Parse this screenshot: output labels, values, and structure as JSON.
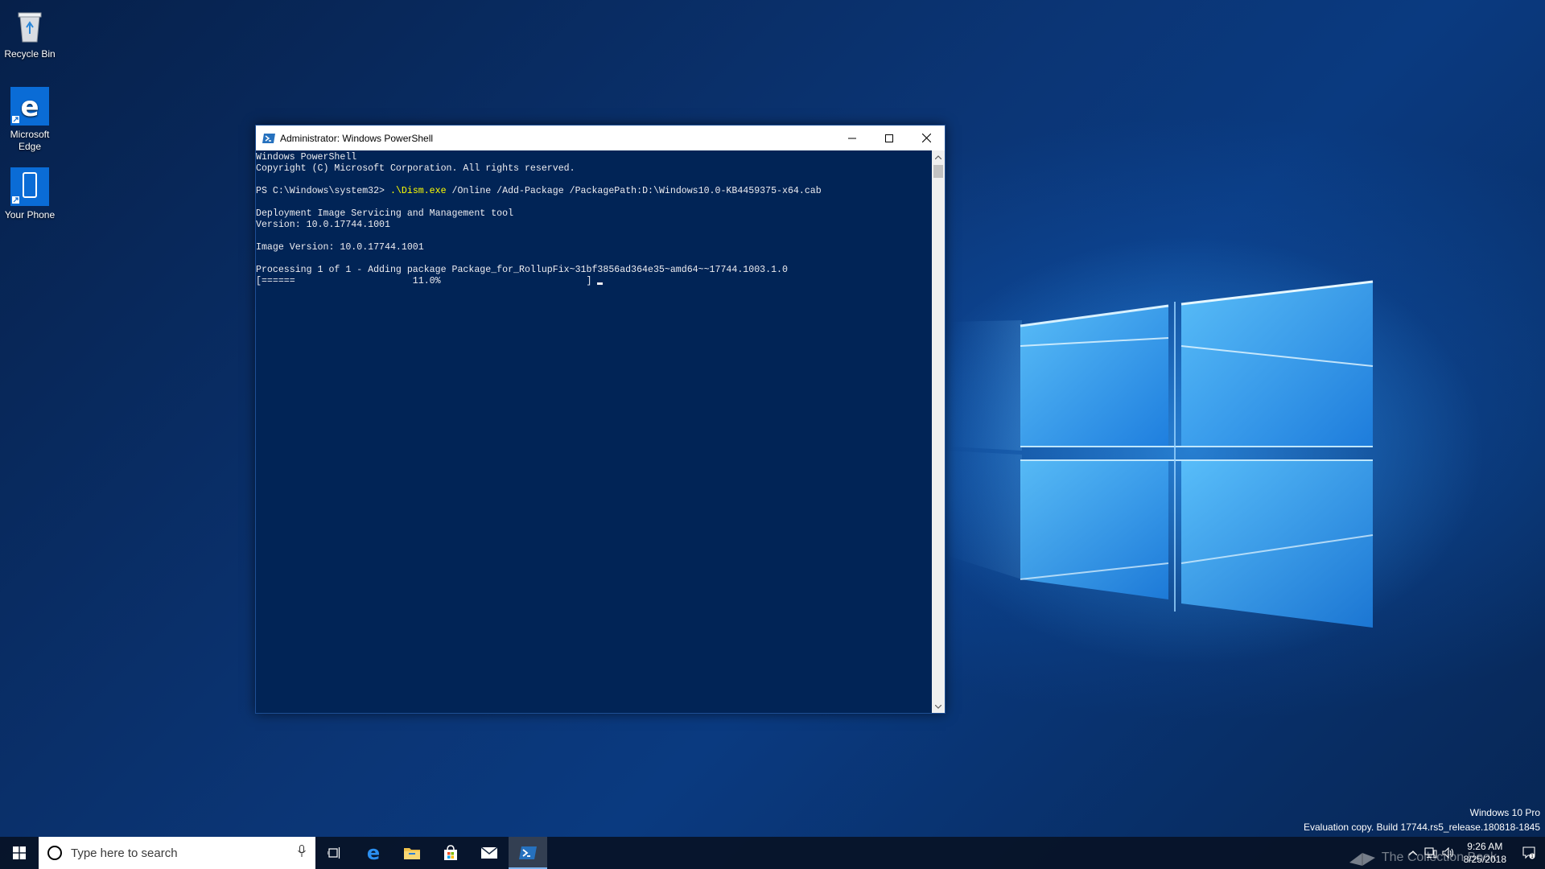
{
  "desktop": {
    "icons": [
      {
        "label": "Recycle Bin",
        "icon": "recycle-bin-icon"
      },
      {
        "label": "Microsoft Edge",
        "icon": "edge-icon"
      },
      {
        "label": "Your Phone",
        "icon": "phone-icon"
      }
    ]
  },
  "window": {
    "title": "Administrator: Windows PowerShell",
    "icon": "powershell-icon",
    "controls": {
      "minimize": "minimize-icon",
      "maximize": "maximize-icon",
      "close": "close-icon"
    }
  },
  "console": {
    "lines": [
      "Windows PowerShell",
      "Copyright (C) Microsoft Corporation. All rights reserved.",
      "",
      "",
      "",
      "Deployment Image Servicing and Management tool",
      "Version: 10.0.17744.1001",
      "",
      "Image Version: 10.0.17744.1001",
      "",
      "Processing 1 of 1 - Adding package Package_for_RollupFix~31bf3856ad364e35~amd64~~17744.1003.1.0",
      "[======                     11.0%                          ] "
    ],
    "prompt": "PS C:\\Windows\\system32> ",
    "command_exe": ".\\Dism.exe",
    "command_args": " /Online /Add-Package /PackagePath:D:\\Windows10.0-KB4459375-x64.cab",
    "progress_percent": 11.0
  },
  "watermark": {
    "edition": "Windows 10 Pro",
    "build": "Evaluation copy. Build 17744.rs5_release.180818-1845"
  },
  "taskbar": {
    "search_placeholder": "Type here to search",
    "apps": [
      "task-view-icon",
      "edge-icon",
      "file-explorer-icon",
      "store-icon",
      "mail-icon",
      "powershell-icon"
    ],
    "active_app": "powershell-icon",
    "clock_time": "9:26 AM",
    "clock_date": "8/25/2018",
    "tray_logo_text": "The Collection Book"
  },
  "colors": {
    "console_bg": "#012456",
    "console_fg": "#eeedf0",
    "command_highlight": "#ffff00",
    "accent": "#0078d7"
  }
}
